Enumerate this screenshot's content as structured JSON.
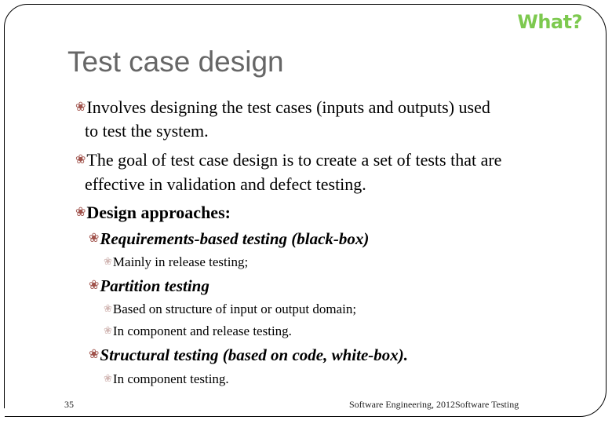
{
  "header": {
    "tag": "What?",
    "tag_color": "#7dc94f"
  },
  "slide": {
    "title": "Test case design",
    "bullet_glyph": "❀",
    "items": [
      {
        "level": 1,
        "text": "Involves designing the test cases (inputs and outputs) used",
        "cont": "to test the system."
      },
      {
        "level": 1,
        "text": "The goal of test case design is to create a set of tests that are",
        "cont": "effective in validation and defect testing."
      },
      {
        "level": 1,
        "text": "Design approaches:"
      },
      {
        "level": 2,
        "text": "Requirements-based testing (black-box)"
      },
      {
        "level": 3,
        "text": "Mainly in release testing;"
      },
      {
        "level": 2,
        "text": "Partition testing"
      },
      {
        "level": 3,
        "text": "Based on structure of input or output domain;"
      },
      {
        "level": 3,
        "text": "In component and release testing."
      },
      {
        "level": 2,
        "text": "Structural testing (based on code, white-box)."
      },
      {
        "level": 3,
        "text": "In component testing."
      }
    ]
  },
  "footer": {
    "page_number": "35",
    "caption": "Software Engineering,  2012Software  Testing"
  }
}
